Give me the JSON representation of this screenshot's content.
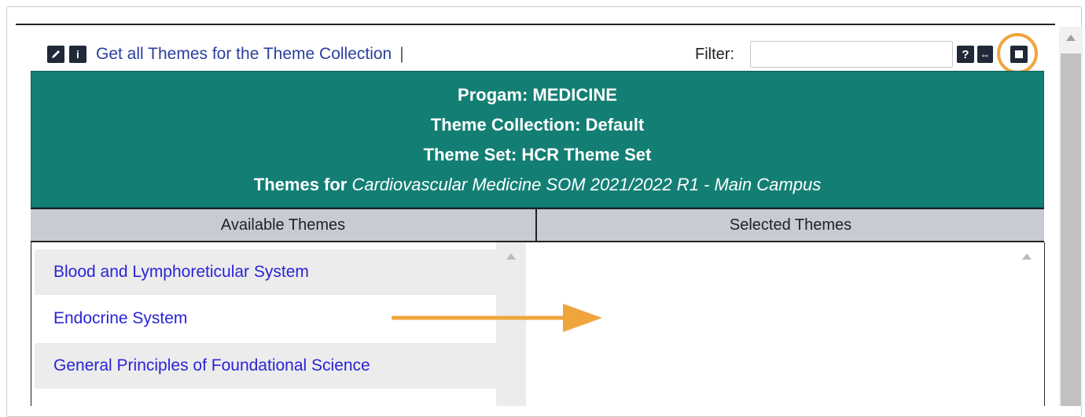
{
  "toolbar": {
    "edit_icon": "pencil-icon",
    "info_icon": "info-icon",
    "info_glyph": "i",
    "link_text": "Get all Themes for the Theme Collection",
    "separator": "|"
  },
  "filter": {
    "label": "Filter:",
    "value": "",
    "help_glyph": "?",
    "expand_glyph": "⇔"
  },
  "header": {
    "program": "Progam: MEDICINE",
    "collection": "Theme Collection: Default",
    "theme_set": "Theme Set: HCR Theme Set",
    "themes_for_label": "Themes for ",
    "themes_for_course": "Cardiovascular Medicine SOM 2021/2022 R1 - Main Campus"
  },
  "columns": {
    "available": "Available Themes",
    "selected": "Selected Themes"
  },
  "available_themes": [
    "Blood and Lymphoreticular System",
    "Endocrine System",
    "General Principles of Foundational Science"
  ],
  "colors": {
    "header_bg": "#137f74",
    "link": "#2a23d6",
    "annotation": "#f0a53c"
  }
}
